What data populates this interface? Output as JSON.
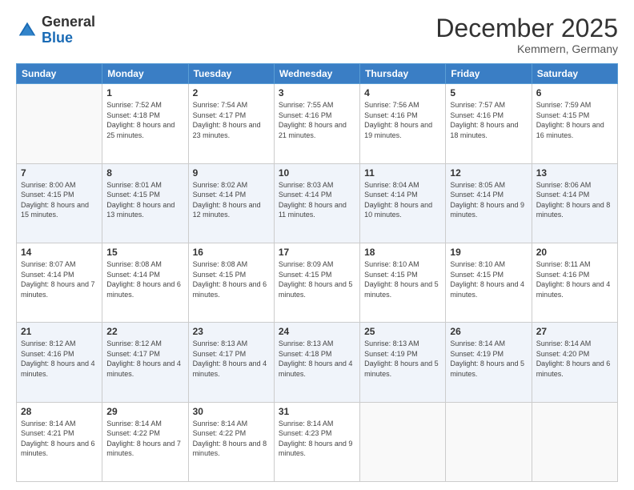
{
  "header": {
    "logo_general": "General",
    "logo_blue": "Blue",
    "month_title": "December 2025",
    "location": "Kemmern, Germany"
  },
  "days_of_week": [
    "Sunday",
    "Monday",
    "Tuesday",
    "Wednesday",
    "Thursday",
    "Friday",
    "Saturday"
  ],
  "weeks": [
    [
      {
        "day": "",
        "sunrise": "",
        "sunset": "",
        "daylight": ""
      },
      {
        "day": "1",
        "sunrise": "Sunrise: 7:52 AM",
        "sunset": "Sunset: 4:18 PM",
        "daylight": "Daylight: 8 hours and 25 minutes."
      },
      {
        "day": "2",
        "sunrise": "Sunrise: 7:54 AM",
        "sunset": "Sunset: 4:17 PM",
        "daylight": "Daylight: 8 hours and 23 minutes."
      },
      {
        "day": "3",
        "sunrise": "Sunrise: 7:55 AM",
        "sunset": "Sunset: 4:16 PM",
        "daylight": "Daylight: 8 hours and 21 minutes."
      },
      {
        "day": "4",
        "sunrise": "Sunrise: 7:56 AM",
        "sunset": "Sunset: 4:16 PM",
        "daylight": "Daylight: 8 hours and 19 minutes."
      },
      {
        "day": "5",
        "sunrise": "Sunrise: 7:57 AM",
        "sunset": "Sunset: 4:16 PM",
        "daylight": "Daylight: 8 hours and 18 minutes."
      },
      {
        "day": "6",
        "sunrise": "Sunrise: 7:59 AM",
        "sunset": "Sunset: 4:15 PM",
        "daylight": "Daylight: 8 hours and 16 minutes."
      }
    ],
    [
      {
        "day": "7",
        "sunrise": "Sunrise: 8:00 AM",
        "sunset": "Sunset: 4:15 PM",
        "daylight": "Daylight: 8 hours and 15 minutes."
      },
      {
        "day": "8",
        "sunrise": "Sunrise: 8:01 AM",
        "sunset": "Sunset: 4:15 PM",
        "daylight": "Daylight: 8 hours and 13 minutes."
      },
      {
        "day": "9",
        "sunrise": "Sunrise: 8:02 AM",
        "sunset": "Sunset: 4:14 PM",
        "daylight": "Daylight: 8 hours and 12 minutes."
      },
      {
        "day": "10",
        "sunrise": "Sunrise: 8:03 AM",
        "sunset": "Sunset: 4:14 PM",
        "daylight": "Daylight: 8 hours and 11 minutes."
      },
      {
        "day": "11",
        "sunrise": "Sunrise: 8:04 AM",
        "sunset": "Sunset: 4:14 PM",
        "daylight": "Daylight: 8 hours and 10 minutes."
      },
      {
        "day": "12",
        "sunrise": "Sunrise: 8:05 AM",
        "sunset": "Sunset: 4:14 PM",
        "daylight": "Daylight: 8 hours and 9 minutes."
      },
      {
        "day": "13",
        "sunrise": "Sunrise: 8:06 AM",
        "sunset": "Sunset: 4:14 PM",
        "daylight": "Daylight: 8 hours and 8 minutes."
      }
    ],
    [
      {
        "day": "14",
        "sunrise": "Sunrise: 8:07 AM",
        "sunset": "Sunset: 4:14 PM",
        "daylight": "Daylight: 8 hours and 7 minutes."
      },
      {
        "day": "15",
        "sunrise": "Sunrise: 8:08 AM",
        "sunset": "Sunset: 4:14 PM",
        "daylight": "Daylight: 8 hours and 6 minutes."
      },
      {
        "day": "16",
        "sunrise": "Sunrise: 8:08 AM",
        "sunset": "Sunset: 4:15 PM",
        "daylight": "Daylight: 8 hours and 6 minutes."
      },
      {
        "day": "17",
        "sunrise": "Sunrise: 8:09 AM",
        "sunset": "Sunset: 4:15 PM",
        "daylight": "Daylight: 8 hours and 5 minutes."
      },
      {
        "day": "18",
        "sunrise": "Sunrise: 8:10 AM",
        "sunset": "Sunset: 4:15 PM",
        "daylight": "Daylight: 8 hours and 5 minutes."
      },
      {
        "day": "19",
        "sunrise": "Sunrise: 8:10 AM",
        "sunset": "Sunset: 4:15 PM",
        "daylight": "Daylight: 8 hours and 4 minutes."
      },
      {
        "day": "20",
        "sunrise": "Sunrise: 8:11 AM",
        "sunset": "Sunset: 4:16 PM",
        "daylight": "Daylight: 8 hours and 4 minutes."
      }
    ],
    [
      {
        "day": "21",
        "sunrise": "Sunrise: 8:12 AM",
        "sunset": "Sunset: 4:16 PM",
        "daylight": "Daylight: 8 hours and 4 minutes."
      },
      {
        "day": "22",
        "sunrise": "Sunrise: 8:12 AM",
        "sunset": "Sunset: 4:17 PM",
        "daylight": "Daylight: 8 hours and 4 minutes."
      },
      {
        "day": "23",
        "sunrise": "Sunrise: 8:13 AM",
        "sunset": "Sunset: 4:17 PM",
        "daylight": "Daylight: 8 hours and 4 minutes."
      },
      {
        "day": "24",
        "sunrise": "Sunrise: 8:13 AM",
        "sunset": "Sunset: 4:18 PM",
        "daylight": "Daylight: 8 hours and 4 minutes."
      },
      {
        "day": "25",
        "sunrise": "Sunrise: 8:13 AM",
        "sunset": "Sunset: 4:19 PM",
        "daylight": "Daylight: 8 hours and 5 minutes."
      },
      {
        "day": "26",
        "sunrise": "Sunrise: 8:14 AM",
        "sunset": "Sunset: 4:19 PM",
        "daylight": "Daylight: 8 hours and 5 minutes."
      },
      {
        "day": "27",
        "sunrise": "Sunrise: 8:14 AM",
        "sunset": "Sunset: 4:20 PM",
        "daylight": "Daylight: 8 hours and 6 minutes."
      }
    ],
    [
      {
        "day": "28",
        "sunrise": "Sunrise: 8:14 AM",
        "sunset": "Sunset: 4:21 PM",
        "daylight": "Daylight: 8 hours and 6 minutes."
      },
      {
        "day": "29",
        "sunrise": "Sunrise: 8:14 AM",
        "sunset": "Sunset: 4:22 PM",
        "daylight": "Daylight: 8 hours and 7 minutes."
      },
      {
        "day": "30",
        "sunrise": "Sunrise: 8:14 AM",
        "sunset": "Sunset: 4:22 PM",
        "daylight": "Daylight: 8 hours and 8 minutes."
      },
      {
        "day": "31",
        "sunrise": "Sunrise: 8:14 AM",
        "sunset": "Sunset: 4:23 PM",
        "daylight": "Daylight: 8 hours and 9 minutes."
      },
      {
        "day": "",
        "sunrise": "",
        "sunset": "",
        "daylight": ""
      },
      {
        "day": "",
        "sunrise": "",
        "sunset": "",
        "daylight": ""
      },
      {
        "day": "",
        "sunrise": "",
        "sunset": "",
        "daylight": ""
      }
    ]
  ]
}
